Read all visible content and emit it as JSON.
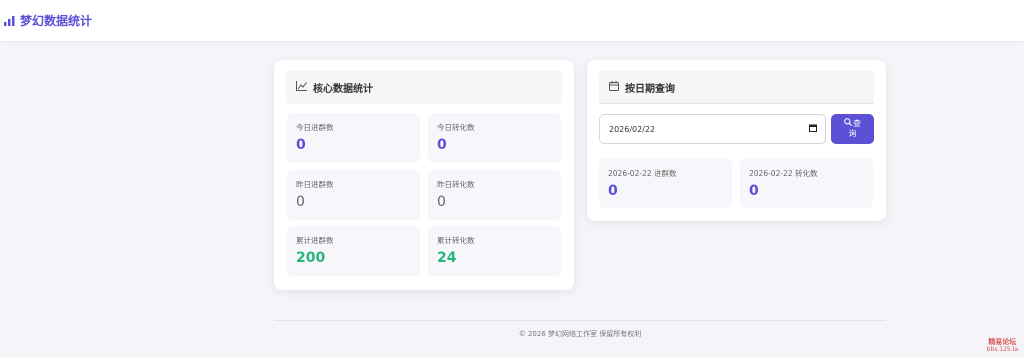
{
  "header": {
    "title": "梦幻数据统计",
    "icon": "bar-chart-icon",
    "accent_color": "#5b50d6"
  },
  "core_stats": {
    "title": "核心数据统计",
    "icon": "line-chart-icon",
    "items": [
      {
        "label": "今日进群数",
        "value": "0"
      },
      {
        "label": "今日转化数",
        "value": "0"
      },
      {
        "label": "昨日进群数",
        "value": "0"
      },
      {
        "label": "昨日转化数",
        "value": "0"
      },
      {
        "label": "累计进群数",
        "value": "200"
      },
      {
        "label": "累计转化数",
        "value": "24"
      }
    ]
  },
  "date_query": {
    "title": "按日期查询",
    "icon": "calendar-icon",
    "date_value": "2026/02/22",
    "button_line1": "查",
    "button_line2": "询",
    "results": [
      {
        "label": "2026-02-22 进群数",
        "value": "0"
      },
      {
        "label": "2026-02-22 转化数",
        "value": "0"
      }
    ]
  },
  "footer": {
    "text": "© 2026 梦幻网络工作室 保留所有权利"
  },
  "watermark": {
    "line1": "精易论坛",
    "line2": "bbs.125.la"
  }
}
